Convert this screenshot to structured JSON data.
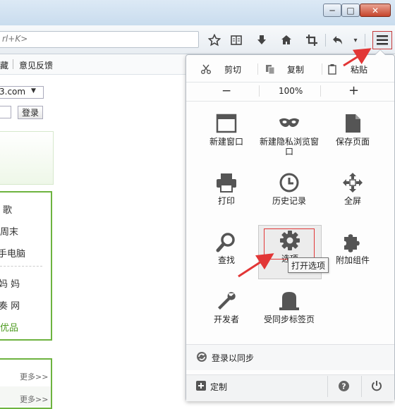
{
  "titlebar": {
    "minimize_label": "─",
    "maximize_label": "□",
    "close_label": "✕"
  },
  "navbar": {
    "url_text": "rl+K>",
    "icons": [
      "star-icon",
      "reading-list-icon",
      "download-icon",
      "home-icon",
      "screenshot-icon",
      "back-icon",
      "dropdown-icon",
      "hamburger-menu-icon"
    ]
  },
  "bookmarks": {
    "item1": "藏",
    "item2": "意见反馈"
  },
  "left": {
    "mail_domain": "3.com",
    "login_button": "登录",
    "list_items": [
      "歌",
      "周末",
      "手电脑",
      "妈 妈",
      "奏 网",
      "优品"
    ],
    "more1": "更多>>",
    "more2": "更多>>"
  },
  "panel": {
    "edit": {
      "cut": "剪切",
      "copy": "复制",
      "paste": "粘贴"
    },
    "zoom": {
      "minus": "−",
      "level": "100%",
      "plus": "+"
    },
    "tiles": [
      {
        "label": "新建窗口",
        "icon": "new-window-icon"
      },
      {
        "label": "新建隐私浏览窗口",
        "icon": "private-mask-icon"
      },
      {
        "label": "保存页面",
        "icon": "save-page-icon"
      },
      {
        "label": "打印",
        "icon": "printer-icon"
      },
      {
        "label": "历史记录",
        "icon": "history-clock-icon"
      },
      {
        "label": "全屏",
        "icon": "fullscreen-icon"
      },
      {
        "label": "查找",
        "icon": "search-icon"
      },
      {
        "label": "选项",
        "icon": "gear-icon"
      },
      {
        "label": "附加组件",
        "icon": "puzzle-icon"
      },
      {
        "label": "开发者",
        "icon": "wrench-icon"
      },
      {
        "label": "受同步标签页",
        "icon": "synced-tabs-icon"
      }
    ],
    "tooltip": "打开选项",
    "sync_label": "登录以同步",
    "customize_label": "定制"
  },
  "colors": {
    "highlight_red": "#e23636",
    "green_border": "#6db33f",
    "icon_gray": "#666666"
  }
}
